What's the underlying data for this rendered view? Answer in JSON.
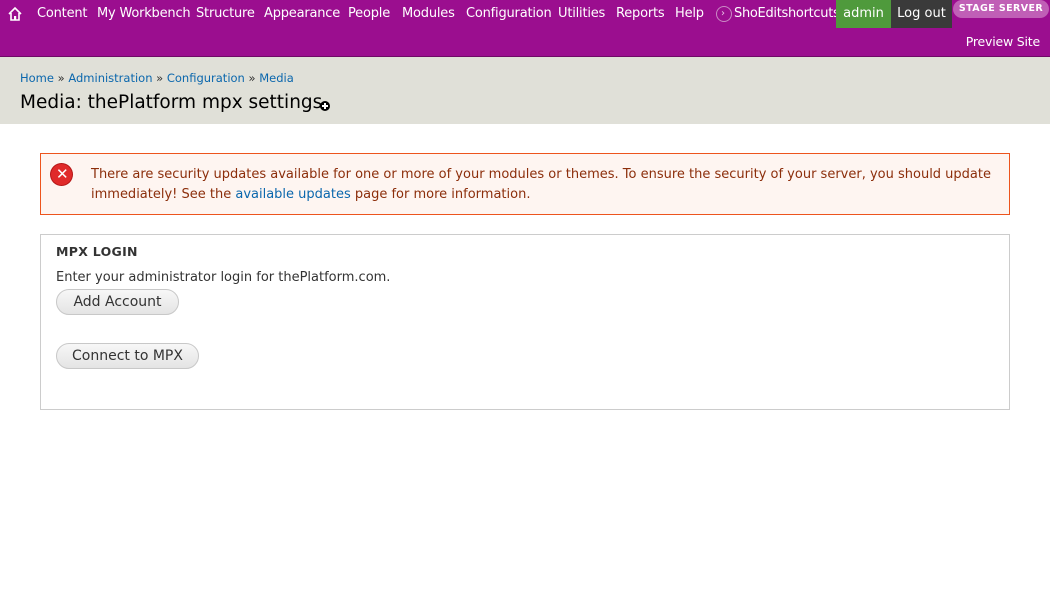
{
  "toolbar": {
    "home_icon": "home-icon",
    "menu": [
      "Content",
      "My Workbench",
      "Structure",
      "Appearance",
      "People",
      "Modules",
      "Configuration",
      "Utilities",
      "Reports",
      "Help"
    ],
    "shortcuts_toggle_icon": "chevron-right-circle-icon",
    "shortcuts_label": "ShoEditshortcuts",
    "admin_label": "admin",
    "logout_label": "Log out",
    "stage_badge": "STAGE SERVER",
    "preview_site": "Preview Site",
    "colors": {
      "background": "#9b0e8f",
      "admin": "#4f9a3c",
      "logout": "#3a3a3a",
      "badge": "#c05fb6"
    }
  },
  "header": {
    "breadcrumb": [
      "Home",
      "Administration",
      "Configuration",
      "Media"
    ],
    "breadcrumb_separator": "»",
    "title": "Media: thePlatform mpx settings",
    "add_shortcut_icon": "plus-circle-icon"
  },
  "error_message": {
    "icon": "error-x-icon",
    "text_before": "There are security updates available for one or more of your modules or themes. To ensure the security of your server, you should update immediately! See the ",
    "link": "available updates",
    "text_after": " page for more information."
  },
  "mpx_login": {
    "legend": "MPX LOGIN",
    "description": "Enter your administrator login for thePlatform.com.",
    "add_account_button": "Add Account",
    "connect_button": "Connect to MPX"
  }
}
